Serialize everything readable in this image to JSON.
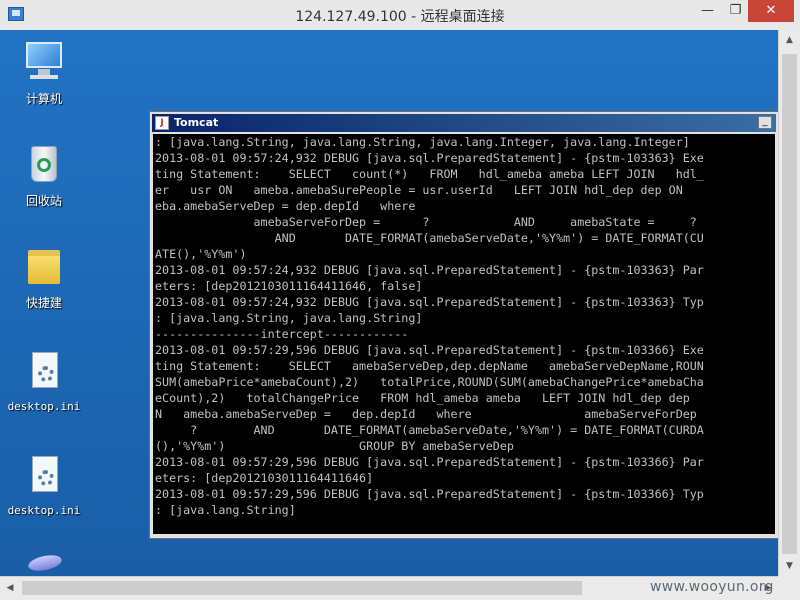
{
  "window": {
    "title": "124.127.49.100 - 远程桌面连接",
    "minimize_glyph": "—",
    "maximize_glyph": "❐",
    "close_glyph": "✕"
  },
  "desktop": {
    "icons": [
      {
        "label": "计算机",
        "icon": "computer-icon"
      },
      {
        "label": "回收站",
        "icon": "recycle-bin-icon"
      },
      {
        "label": "快捷建",
        "icon": "folder-icon"
      },
      {
        "label": "desktop.ini",
        "icon": "settings-file-icon"
      },
      {
        "label": "desktop.ini",
        "icon": "settings-file-icon"
      }
    ]
  },
  "console": {
    "title": "Tomcat",
    "minimize_glyph": "_",
    "lines": [
      ": [java.lang.String, java.lang.String, java.lang.Integer, java.lang.Integer]",
      "2013-08-01 09:57:24,932 DEBUG [java.sql.PreparedStatement] - {pstm-103363} Exe",
      "ting Statement:    SELECT   count(*)   FROM   hdl_ameba ameba LEFT JOIN   hdl_",
      "er   usr ON   ameba.amebaSurePeople = usr.userId   LEFT JOIN hdl_dep dep ON  ",
      "eba.amebaServeDep = dep.depId   where",
      "              amebaServeForDep =      ?            AND     amebaState =     ? ",
      "                 AND       DATE_FORMAT(amebaServeDate,'%Y%m') = DATE_FORMAT(CU",
      "ATE(),'%Y%m')",
      "2013-08-01 09:57:24,932 DEBUG [java.sql.PreparedStatement] - {pstm-103363} Par",
      "eters: [dep2012103011164411646, false]",
      "2013-08-01 09:57:24,932 DEBUG [java.sql.PreparedStatement] - {pstm-103363} Typ",
      ": [java.lang.String, java.lang.String]",
      "---------------intercept------------",
      "2013-08-01 09:57:29,596 DEBUG [java.sql.PreparedStatement] - {pstm-103366} Exe",
      "ting Statement:    SELECT   amebaServeDep,dep.depName   amebaServeDepName,ROUN",
      "SUM(amebaPrice*amebaCount),2)   totalPrice,ROUND(SUM(amebaChangePrice*amebaCha",
      "eCount),2)   totalChangePrice   FROM hdl_ameba ameba   LEFT JOIN hdl_dep dep ",
      "N   ameba.amebaServeDep =   dep.depId   where                amebaServeForDep",
      "     ?        AND       DATE_FORMAT(amebaServeDate,'%Y%m') = DATE_FORMAT(CURDA",
      "(),'%Y%m')                   GROUP BY amebaServeDep",
      "2013-08-01 09:57:29,596 DEBUG [java.sql.PreparedStatement] - {pstm-103366} Par",
      "eters: [dep2012103011164411646]",
      "2013-08-01 09:57:29,596 DEBUG [java.sql.PreparedStatement] - {pstm-103366} Typ",
      ": [java.lang.String]"
    ]
  },
  "watermark": "www.wooyun.org",
  "colors": {
    "desktop_bg": "#1d6bb3",
    "close_button": "#c74637",
    "console_bg": "#000000",
    "console_text": "#c0c0c0"
  }
}
